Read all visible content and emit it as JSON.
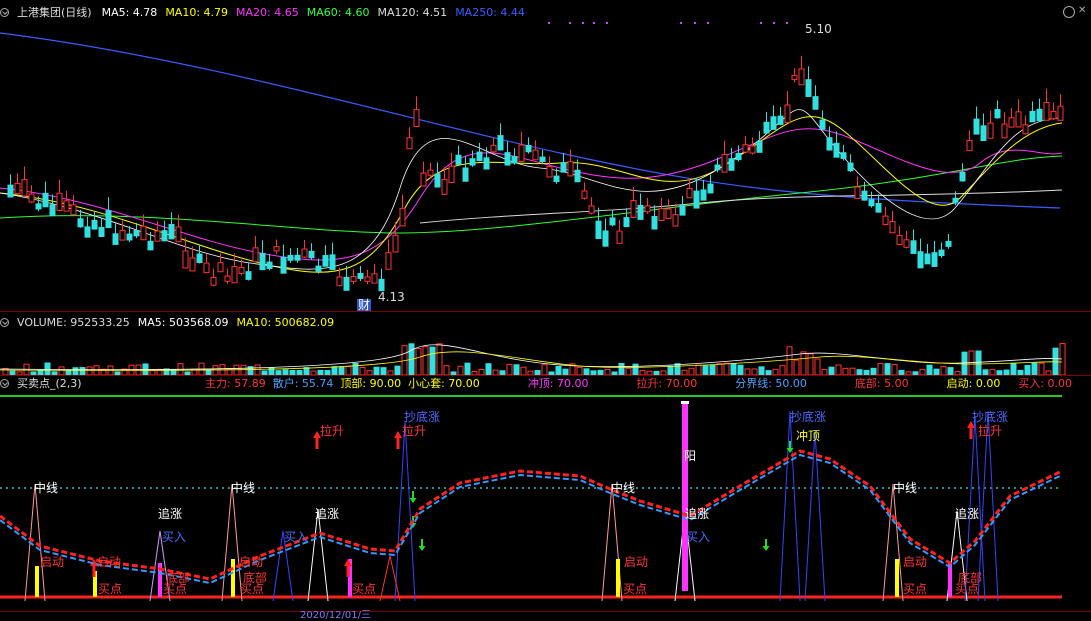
{
  "main_header": {
    "title": "上港集团(日线)",
    "ma5": "MA5: 4.78",
    "ma10": "MA10: 4.79",
    "ma20": "MA20: 4.65",
    "ma60": "MA60: 4.60",
    "ma120": "MA120: 4.51",
    "ma250": "MA250: 4.44"
  },
  "main_chart": {
    "high_label": "5.10",
    "low_label": "4.13",
    "marker_label": "财"
  },
  "volume_header": {
    "volume": "VOLUME: 952533.25",
    "ma5": "MA5: 503568.09",
    "ma10": "MA10: 500682.09"
  },
  "indicator_header": {
    "name": "买卖点_(2,3)",
    "items": [
      "主力: 57.89",
      "散户: 55.74",
      "顶部: 90.00",
      "小心套: 70.00",
      "冲顶: 70.00",
      "拉升: 70.00",
      "分界线: 50.00",
      "底部: 5.00",
      "启动: 0.00",
      "买入: 0.00"
    ]
  },
  "signals": {
    "lashen": "拉升",
    "chongding": "冲顶",
    "zhuizhang": "追涨",
    "qidong": "启动",
    "maidian": "买点",
    "dibu": "底部",
    "mairu": "买入",
    "yang": "阳",
    "chaodizhang": "抄底涨",
    "zhongxian": "中线"
  },
  "bottom_axis": {
    "date_fragment": "2020/12/01/三"
  },
  "colors": {
    "ma5": "#ffffff",
    "ma10": "#ffff00",
    "ma20": "#ff33ff",
    "ma60": "#33ff33",
    "ma120": "#dddddd",
    "ma250": "#3a5cff",
    "up": "#ff3333",
    "down": "#33e0e0"
  }
}
